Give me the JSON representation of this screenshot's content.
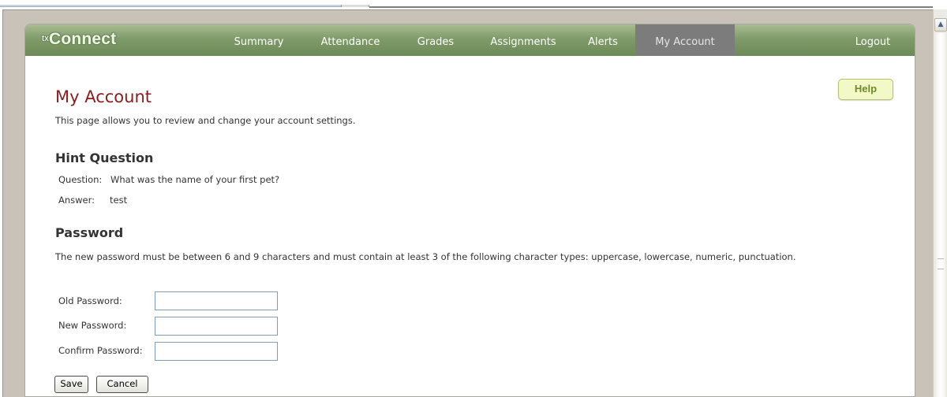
{
  "app": {
    "brand_prefix": "tx",
    "brand_name": "Connect"
  },
  "nav": {
    "items": [
      {
        "label": "Summary",
        "active": false
      },
      {
        "label": "Attendance",
        "active": false
      },
      {
        "label": "Grades",
        "active": false
      },
      {
        "label": "Assignments",
        "active": false
      },
      {
        "label": "Alerts",
        "active": false
      },
      {
        "label": "My Account",
        "active": true
      }
    ],
    "logout_label": "Logout"
  },
  "page": {
    "title": "My Account",
    "description": "This page allows you to review and change your account settings.",
    "help_label": "Help"
  },
  "hint": {
    "heading": "Hint Question",
    "question_label": "Question:",
    "question_value": "What was the name of your first pet?",
    "answer_label": "Answer:",
    "answer_value": "test"
  },
  "password": {
    "heading": "Password",
    "description": "The new password must be between 6 and 9 characters and must contain at least 3 of the following character types: uppercase, lowercase, numeric, punctuation.",
    "fields": {
      "old_label": "Old Password:",
      "old_value": "",
      "new_label": "New Password:",
      "new_value": "",
      "confirm_label": "Confirm Password:",
      "confirm_value": ""
    },
    "save_label": "Save",
    "cancel_label": "Cancel"
  },
  "colors": {
    "nav_green": "#7f9b69",
    "nav_active": "#7c7c7c",
    "title_red": "#8e1b1b",
    "help_bg": "#f2f8c6",
    "help_text": "#6f8a28"
  },
  "icons": {
    "scroll_up": "scroll-up-arrow-icon"
  }
}
